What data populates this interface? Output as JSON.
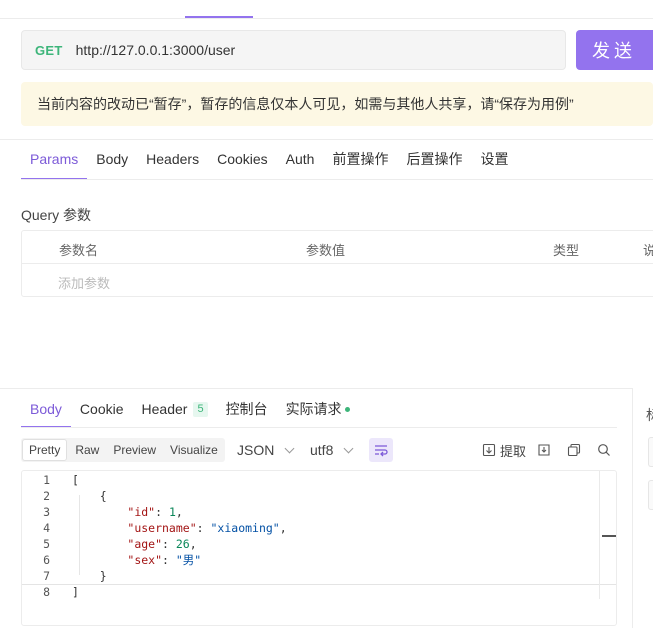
{
  "request": {
    "method": "GET",
    "url": "http://127.0.0.1:3000/user",
    "send_label": "发送"
  },
  "notice": "当前内容的改动已“暂存”，暂存的信息仅本人可见，如需与其他人共享，请“保存为用例”",
  "request_tabs": [
    "Params",
    "Body",
    "Headers",
    "Cookies",
    "Auth",
    "前置操作",
    "后置操作",
    "设置"
  ],
  "query": {
    "title": "Query 参数",
    "columns": [
      "参数名",
      "参数值",
      "类型",
      "说"
    ],
    "placeholder": "添加参数"
  },
  "response_tabs": {
    "body": "Body",
    "cookie": "Cookie",
    "header": "Header",
    "header_count": "5",
    "console": "控制台",
    "actual_request": "实际请求"
  },
  "right_panel": {
    "stub": "标"
  },
  "view_modes": [
    "Pretty",
    "Raw",
    "Preview",
    "Visualize"
  ],
  "format_select": "JSON",
  "encoding_select": "utf8",
  "tools": {
    "extract": "提取"
  },
  "code_lines": [
    {
      "n": "1",
      "t": "["
    },
    {
      "n": "2",
      "t": "    {"
    },
    {
      "n": "3",
      "t": "        \"id\": 1,"
    },
    {
      "n": "4",
      "t": "        \"username\": \"xiaoming\","
    },
    {
      "n": "5",
      "t": "        \"age\": 26,"
    },
    {
      "n": "6",
      "t": "        \"sex\": \"男\""
    },
    {
      "n": "7",
      "t": "    }"
    },
    {
      "n": "8",
      "t": "]"
    }
  ],
  "colors": {
    "accent": "#9373ee",
    "method_get": "#3db57a",
    "notice_bg": "#fdf8e4"
  }
}
